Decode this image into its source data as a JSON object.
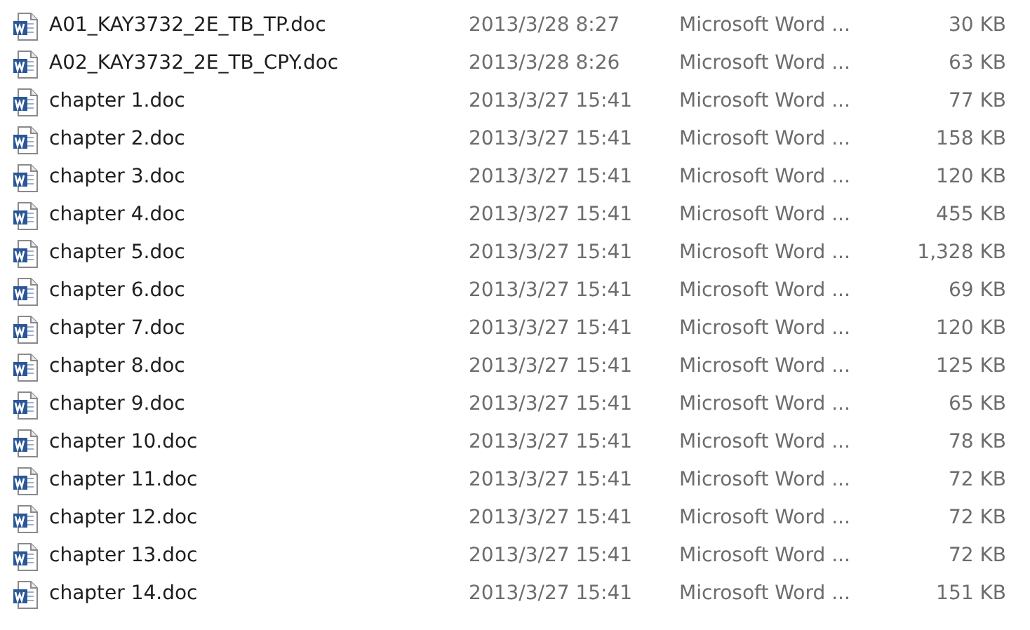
{
  "files": [
    {
      "name": "A01_KAY3732_2E_TB_TP.doc",
      "modified": "2013/3/28 8:27",
      "type": "Microsoft Word ...",
      "size": "30 KB"
    },
    {
      "name": "A02_KAY3732_2E_TB_CPY.doc",
      "modified": "2013/3/28 8:26",
      "type": "Microsoft Word ...",
      "size": "63 KB"
    },
    {
      "name": "chapter 1.doc",
      "modified": "2013/3/27 15:41",
      "type": "Microsoft Word ...",
      "size": "77 KB"
    },
    {
      "name": "chapter 2.doc",
      "modified": "2013/3/27 15:41",
      "type": "Microsoft Word ...",
      "size": "158 KB"
    },
    {
      "name": "chapter 3.doc",
      "modified": "2013/3/27 15:41",
      "type": "Microsoft Word ...",
      "size": "120 KB"
    },
    {
      "name": "chapter 4.doc",
      "modified": "2013/3/27 15:41",
      "type": "Microsoft Word ...",
      "size": "455 KB"
    },
    {
      "name": "chapter 5.doc",
      "modified": "2013/3/27 15:41",
      "type": "Microsoft Word ...",
      "size": "1,328 KB"
    },
    {
      "name": "chapter 6.doc",
      "modified": "2013/3/27 15:41",
      "type": "Microsoft Word ...",
      "size": "69 KB"
    },
    {
      "name": "chapter 7.doc",
      "modified": "2013/3/27 15:41",
      "type": "Microsoft Word ...",
      "size": "120 KB"
    },
    {
      "name": "chapter 8.doc",
      "modified": "2013/3/27 15:41",
      "type": "Microsoft Word ...",
      "size": "125 KB"
    },
    {
      "name": "chapter 9.doc",
      "modified": "2013/3/27 15:41",
      "type": "Microsoft Word ...",
      "size": "65 KB"
    },
    {
      "name": "chapter 10.doc",
      "modified": "2013/3/27 15:41",
      "type": "Microsoft Word ...",
      "size": "78 KB"
    },
    {
      "name": "chapter 11.doc",
      "modified": "2013/3/27 15:41",
      "type": "Microsoft Word ...",
      "size": "72 KB"
    },
    {
      "name": "chapter 12.doc",
      "modified": "2013/3/27 15:41",
      "type": "Microsoft Word ...",
      "size": "72 KB"
    },
    {
      "name": "chapter 13.doc",
      "modified": "2013/3/27 15:41",
      "type": "Microsoft Word ...",
      "size": "72 KB"
    },
    {
      "name": "chapter 14.doc",
      "modified": "2013/3/27 15:41",
      "type": "Microsoft Word ...",
      "size": "151 KB"
    }
  ]
}
